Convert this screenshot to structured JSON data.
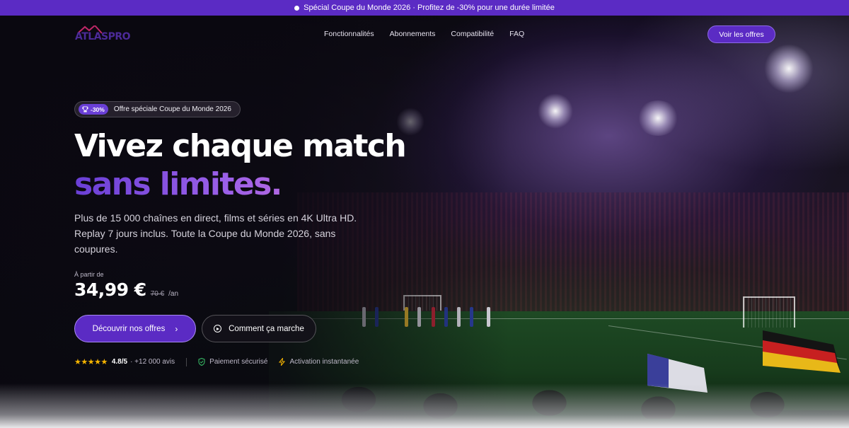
{
  "promo": {
    "text": "Spécial Coupe du Monde 2026 · Profitez de -30% pour une durée limitée"
  },
  "nav": {
    "logo": "ATLASPRO",
    "links": [
      "Fonctionnalités",
      "Abonnements",
      "Compatibilité",
      "FAQ"
    ],
    "cta": "Voir les offres"
  },
  "badge": {
    "discount": "-30%",
    "text": "Offre spéciale Coupe du Monde 2026"
  },
  "headline": {
    "line1": "Vivez chaque match",
    "line2": "sans limites."
  },
  "subtext": "Plus de 15 000 chaînes en direct, films et séries en 4K Ultra HD. Replay 7 jours inclus. Toute la Coupe du Monde 2026, sans coupures.",
  "pricing": {
    "label": "À partir de",
    "price": "34,99 €",
    "old_price": "70 €",
    "unit": "/an"
  },
  "buttons": {
    "primary": "Découvrir nos offres",
    "secondary": "Comment ça marche"
  },
  "trust": {
    "stars": "★★★★★",
    "rating": "4.8/5",
    "reviews": "· +12 000 avis",
    "secure": "Paiement sécurisé",
    "instant": "Activation instantanée"
  },
  "colors": {
    "accent": "#5b2bc4",
    "gradient_start": "#6a3fd6",
    "gradient_end": "#e07ad8",
    "star": "#f5b400",
    "shield": "#39c46a"
  },
  "icons": [
    "sun-dot-icon",
    "trophy-icon",
    "chevron-right-icon",
    "play-circle-icon",
    "shield-check-icon",
    "lightning-icon"
  ]
}
